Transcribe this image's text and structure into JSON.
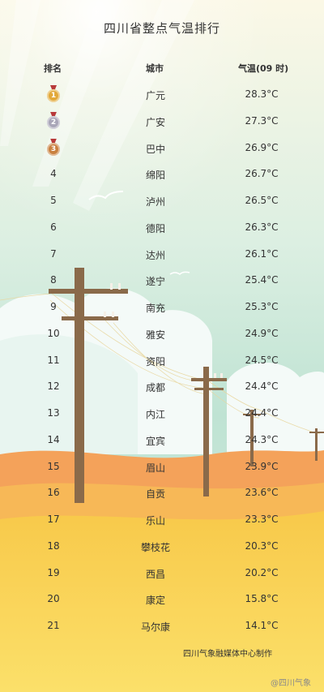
{
  "page": {
    "title": "四川省整点气温排行",
    "footer": "四川气象融媒体中心制作",
    "watermark": "@四川气象"
  },
  "table": {
    "headers": {
      "rank": "排名",
      "city": "城市",
      "temp": "气温(09 时)"
    },
    "rows": [
      {
        "rank": "1",
        "medal": "gold",
        "city": "广元",
        "temp": "28.3°C"
      },
      {
        "rank": "2",
        "medal": "silver",
        "city": "广安",
        "temp": "27.3°C"
      },
      {
        "rank": "3",
        "medal": "bronze",
        "city": "巴中",
        "temp": "26.9°C"
      },
      {
        "rank": "4",
        "city": "绵阳",
        "temp": "26.7°C"
      },
      {
        "rank": "5",
        "city": "泸州",
        "temp": "26.5°C"
      },
      {
        "rank": "6",
        "city": "德阳",
        "temp": "26.3°C"
      },
      {
        "rank": "7",
        "city": "达州",
        "temp": "26.1°C"
      },
      {
        "rank": "8",
        "city": "遂宁",
        "temp": "25.4°C"
      },
      {
        "rank": "9",
        "city": "南充",
        "temp": "25.3°C"
      },
      {
        "rank": "10",
        "city": "雅安",
        "temp": "24.9°C"
      },
      {
        "rank": "11",
        "city": "资阳",
        "temp": "24.5°C"
      },
      {
        "rank": "12",
        "city": "成都",
        "temp": "24.4°C"
      },
      {
        "rank": "13",
        "city": "内江",
        "temp": "24.4°C"
      },
      {
        "rank": "14",
        "city": "宜宾",
        "temp": "24.3°C"
      },
      {
        "rank": "15",
        "city": "眉山",
        "temp": "23.9°C"
      },
      {
        "rank": "16",
        "city": "自贡",
        "temp": "23.6°C"
      },
      {
        "rank": "17",
        "city": "乐山",
        "temp": "23.3°C"
      },
      {
        "rank": "18",
        "city": "攀枝花",
        "temp": "20.3°C"
      },
      {
        "rank": "19",
        "city": "西昌",
        "temp": "20.2°C"
      },
      {
        "rank": "20",
        "city": "康定",
        "temp": "15.8°C"
      },
      {
        "rank": "21",
        "city": "马尔康",
        "temp": "14.1°C"
      }
    ]
  },
  "colors": {
    "sky_top": "#fbf6e3",
    "sky_mid": "#cfe9da",
    "teal": "#a9d9c8",
    "cloud": "#f4faf8",
    "hill_orange": "#f4a25a",
    "field_yellow": "#f9d24a",
    "pole": "#8a6a4a",
    "gold": "#e2a93a",
    "silver": "#a9a6b8",
    "bronze": "#c9803f"
  }
}
